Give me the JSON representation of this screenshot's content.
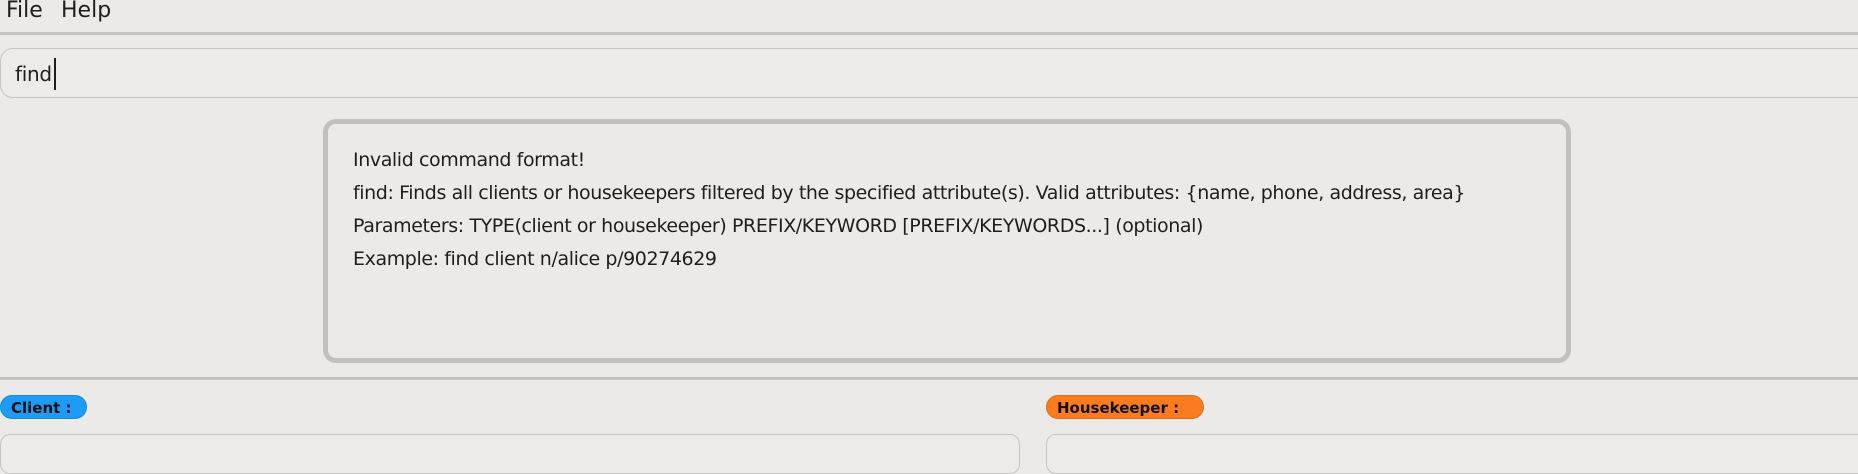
{
  "menu": {
    "file_label": "File",
    "help_label": "Help"
  },
  "command": {
    "value": "find"
  },
  "result": {
    "lines": [
      "Invalid command format!",
      "find: Finds all clients or housekeepers filtered by the specified attribute(s). Valid attributes: {name, phone, address, area}",
      "Parameters: TYPE(client or housekeeper) PREFIX/KEYWORD [PREFIX/KEYWORDS...] (optional)",
      "Example: find client n/alice p/90274629"
    ]
  },
  "lists": {
    "client_label": "Client :",
    "housekeeper_label": "Housekeeper :"
  },
  "colors": {
    "client_badge": "#1e9af7",
    "housekeeper_badge": "#fb7c1e",
    "background": "#eceae8"
  }
}
